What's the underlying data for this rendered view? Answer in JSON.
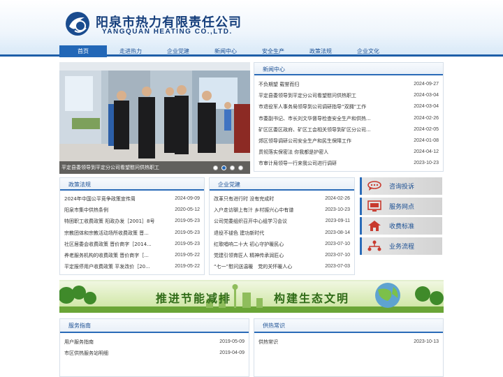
{
  "header": {
    "company_cn": "阳泉市热力有限责任公司",
    "company_en": "YANGQUAN HEATING CO.,LTD."
  },
  "nav": [
    "首页",
    "走进热力",
    "企业党建",
    "新闻中心",
    "安全生产",
    "政策法规",
    "企业文化"
  ],
  "slider": {
    "caption": "平定县委领导到平定分公司看望慰问供热职工",
    "dot_count": 4,
    "active_dot": 2
  },
  "news": {
    "title": "新闻中心",
    "items": [
      {
        "text": "不负期望 载誉而归",
        "date": "2024-09-27"
      },
      {
        "text": "平定县委领导到平定分公司看望慰问供热职工",
        "date": "2024-03-04"
      },
      {
        "text": "市退役军人事务局领导到公司调研指导“双拥”工作",
        "date": "2024-03-04"
      },
      {
        "text": "市委副书记、市长刘文华督导检查安全生产和供热...",
        "date": "2024-02-26"
      },
      {
        "text": "矿区区委区政府、矿区工会相关领导到矿区分公司...",
        "date": "2024-02-05"
      },
      {
        "text": "郊区领导调研公司安全生产和民生保障工作",
        "date": "2024-01-08"
      },
      {
        "text": "贯彻落实保密法 你我都是护密人",
        "date": "2024-04-12"
      },
      {
        "text": "市审计局领导一行来我公司进行调研",
        "date": "2023-10-23"
      }
    ]
  },
  "policy": {
    "title": "政策法规",
    "items": [
      {
        "text": "2024年中国公平竞争政策宣传周",
        "date": "2024-09-09"
      },
      {
        "text": "阳泉市集中供热条例",
        "date": "2020-05-12"
      },
      {
        "text": "特困职工收费政策 阳政办发［2001］8号",
        "date": "2019-05-23"
      },
      {
        "text": "宗教团体和宗教活动场所收费政策 晋...",
        "date": "2019-05-23"
      },
      {
        "text": "社区居委会收费政策 晋价商字［2014...",
        "date": "2019-05-23"
      },
      {
        "text": "养老服务机构的收费政策 晋价商字［...",
        "date": "2019-05-22"
      },
      {
        "text": "平定报停用户收费政策 平发改价［20...",
        "date": "2019-05-22"
      }
    ]
  },
  "party": {
    "title": "企业党建",
    "items": [
      {
        "text": "改革只有进行时 没有完成时",
        "date": "2024-02-26"
      },
      {
        "text": "入户走访聊上有汁 乡村振兴心中有谱",
        "date": "2023-10-23"
      },
      {
        "text": "公司党委组织召开中心组学习会议",
        "date": "2023-09-11"
      },
      {
        "text": "退役不褪色 建功新时代",
        "date": "2023-08-14"
      },
      {
        "text": "红歌唱响二十大 初心守护暖民心",
        "date": "2023-07-10"
      },
      {
        "text": "党建引领育匠人 精神传承润匠心",
        "date": "2023-07-10"
      },
      {
        "text": "“七一”慰问送温暖　党的关怀暖人心",
        "date": "2023-07-03"
      }
    ]
  },
  "side_buttons": [
    {
      "label": "咨询投诉",
      "icon": "consult-icon"
    },
    {
      "label": "服务网点",
      "icon": "monitor-icon"
    },
    {
      "label": "收费标准",
      "icon": "house-icon"
    },
    {
      "label": "业务流程",
      "icon": "process-icon"
    }
  ],
  "banner": {
    "left": "推进节能减排",
    "right": "构建生态文明"
  },
  "service": {
    "title": "服务指南",
    "items": [
      {
        "text": "用户服务指南",
        "date": "2019-05-09"
      },
      {
        "text": "市区供热服务站明细",
        "date": "2019-04-09"
      }
    ]
  },
  "knowledge": {
    "title": "供热常识",
    "items": [
      {
        "text": "供热常识",
        "date": "2023-10-13"
      }
    ]
  },
  "colors": {
    "brand": "#1e5ea8",
    "nav_active": "#2267b7",
    "banner_green": "#2f6b17"
  }
}
